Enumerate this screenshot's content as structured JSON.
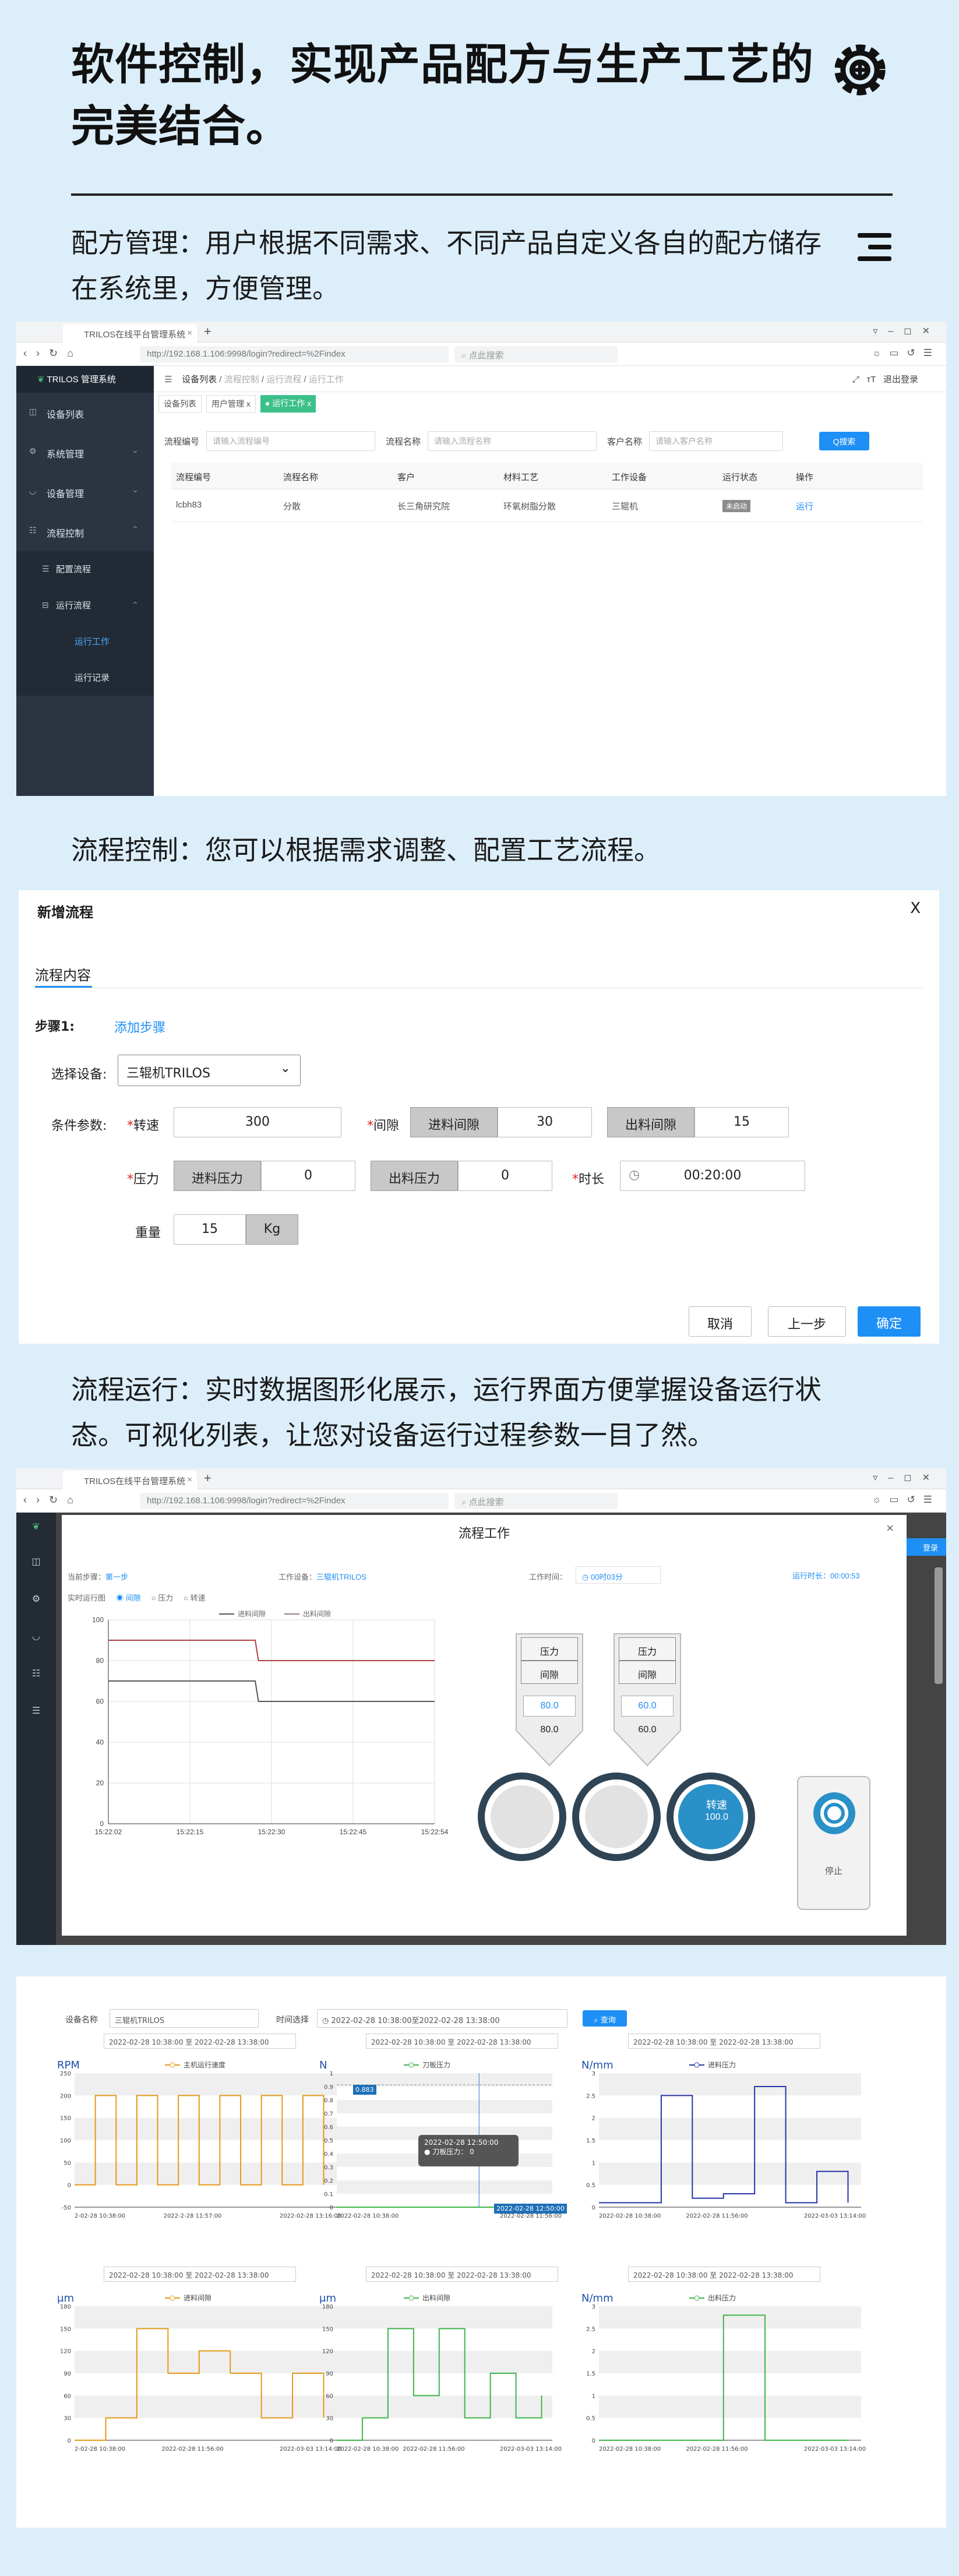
{
  "section1": {
    "title": "软件控制，实现产品配方与生产工艺的完美结合。",
    "gear": "gear-icon"
  },
  "recipe_para": "配方管理：用户根据不同需求、不同产品自定义各自的配方储存在系统里，方便管理。",
  "shot1": {
    "tab": "TRILOS在线平台管理系统",
    "url": "http://192.168.1.106:9998/login?redirect=%2Findex",
    "search_ph": "点此搜索",
    "brand": "TRILOS 管理系统",
    "menu": [
      {
        "label": "设备列表",
        "icon": "◫"
      },
      {
        "label": "系统管理",
        "icon": "⚙"
      },
      {
        "label": "设备管理",
        "icon": "◡"
      },
      {
        "label": "流程控制",
        "icon": "☷"
      }
    ],
    "submenu": [
      {
        "label": "配置流程",
        "icon": "☰"
      },
      {
        "label": "运行流程",
        "icon": "⊟"
      }
    ],
    "subsub": [
      "运行工作",
      "运行记录"
    ],
    "breadcrumb": [
      "设备列表",
      "流程控制",
      "运行流程",
      "运行工作"
    ],
    "header_right": "退出登录",
    "tags": [
      "设备列表",
      "用户管理 x",
      "● 运行工作 x"
    ],
    "filters": [
      {
        "label": "流程编号",
        "ph": "请输入流程编号"
      },
      {
        "label": "流程名称",
        "ph": "请输入流程名称"
      },
      {
        "label": "客户名称",
        "ph": "请输入客户名称"
      }
    ],
    "search_btn": "Q搜索",
    "columns": [
      "流程编号",
      "流程名称",
      "客户",
      "材料工艺",
      "工作设备",
      "运行状态",
      "操作"
    ],
    "row": [
      "lcbh83",
      "分散",
      "长三角研究院",
      "环氧树脂分散",
      "三辊机",
      "未启动",
      "运行"
    ]
  },
  "flow_para": "流程控制：您可以根据需求调整、配置工艺流程。",
  "dialog": {
    "title": "新增流程",
    "close": "X",
    "tab": "流程内容",
    "step": "步骤1:",
    "add_step": "添加步骤",
    "device_label": "选择设备:",
    "device": "三辊机TRILOS",
    "params_label": "条件参数:",
    "speed_label": "转速",
    "speed": "300",
    "gap_label": "间隙",
    "in_gap": "进料间隙",
    "in_gap_val": "30",
    "out_gap": "出料间隙",
    "out_gap_val": "15",
    "pressure_label": "压力",
    "in_p": "进料压力",
    "in_p_val": "0",
    "out_p": "出料压力",
    "out_p_val": "0",
    "time_label": "时长",
    "time": "00:20:00",
    "weight_label": "重量",
    "weight": "15",
    "unit": "Kg",
    "cancel": "取消",
    "prev": "上一步",
    "ok": "确定"
  },
  "run_para": "流程运行：实时数据图形化展示，运行界面方便掌握设备运行状态。可视化列表，让您对设备运行过程参数一目了然。",
  "shot2": {
    "title": "流程工作",
    "close": "×",
    "logout": "登录",
    "cur_step_label": "当前步骤：",
    "cur_step": "第一步",
    "device_label": "工作设备：",
    "device": "三辊机TRILOS",
    "work_time_label": "工作时间：",
    "work_time": "00时03分",
    "run_len_label": "运行时长：",
    "run_len": "00:00:53",
    "monitor_label": "实时运行图",
    "radios": [
      "间隙",
      "压力",
      "转速"
    ],
    "legend": [
      "进料间隙",
      "出料间隙"
    ],
    "p1": {
      "t1": "压力",
      "t2": "间隙",
      "val": "80.0",
      "below": "80.0"
    },
    "p2": {
      "t1": "压力",
      "t2": "间隙",
      "val": "60.0",
      "below": "60.0"
    },
    "rotor_label": "转速",
    "rotor_val": "100.0",
    "stop": "停止"
  },
  "shot3": {
    "device_label": "设备名称",
    "device": "三辊机TRILOS",
    "time_label": "时间选择",
    "range": "2022-02-28 10:38:00至2022-02-28 13:38:00",
    "query": "查询",
    "picker": "2022-02-28 10:38:00 至 2022-02-28 13:38:00",
    "tooltip_time": "2022-02-28 12:50:00",
    "tooltip_val": "● 刀板压力： 0",
    "cursor_y": "0.883",
    "cursor_x": "2022-02-28 12:50:00"
  },
  "chart_data": [
    {
      "type": "line",
      "title": "",
      "legend": [
        "进料间隙",
        "出料间隙"
      ],
      "x": [
        "15:22:02",
        "15:22:15",
        "15:22:30",
        "15:22:45",
        "15:22:54"
      ],
      "ylim": [
        0,
        100
      ],
      "series": [
        {
          "name": "进料间隙",
          "values": [
            90,
            90,
            80,
            80,
            80
          ]
        },
        {
          "name": "出料间隙",
          "values": [
            70,
            70,
            60,
            60,
            60
          ]
        }
      ]
    },
    {
      "type": "line",
      "ylabel": "RPM",
      "legend": [
        "主机运行速度"
      ],
      "ylim": [
        -50,
        250
      ],
      "yticks": [
        "250",
        "200",
        "150",
        "100",
        "50",
        "0",
        "-50"
      ],
      "xticks": [
        "2-02-28 10:38:00",
        "2022-2-28 11:57:00",
        "2022-02-28 13:16:00"
      ],
      "series": [
        {
          "name": "主机运行速度",
          "values": [
            0,
            200,
            0,
            200,
            0,
            200,
            0,
            200,
            0,
            200,
            0,
            200,
            0
          ]
        }
      ]
    },
    {
      "type": "line",
      "ylabel": "N",
      "legend": [
        "刀板压力"
      ],
      "ylim": [
        0,
        1
      ],
      "yticks": [
        "1",
        "0.9",
        "0.8",
        "0.7",
        "0.6",
        "0.5",
        "0.4",
        "0.3",
        "0.2",
        "0.1",
        "0"
      ],
      "xticks": [
        "2022-02-28 10:38:00",
        "2022-02-28 11:56:00"
      ],
      "series": [
        {
          "name": "刀板压力",
          "values": [
            0,
            0,
            0,
            0,
            0
          ]
        }
      ]
    },
    {
      "type": "line",
      "ylabel": "N/mm",
      "legend": [
        "进料压力"
      ],
      "ylim": [
        0,
        3
      ],
      "yticks": [
        "3",
        "2.5",
        "2",
        "1.5",
        "1",
        "0.5",
        "0"
      ],
      "xticks": [
        "2022-02-28 10:38:00",
        "2022-02-28 11:56:00",
        "2022-03-03 13:14:00"
      ],
      "series": [
        {
          "name": "进料压力",
          "values": [
            0.1,
            0.1,
            2.5,
            0.2,
            0.3,
            2.7,
            0.1,
            0.8,
            0.1
          ]
        }
      ]
    },
    {
      "type": "line",
      "ylabel": "μm",
      "legend": [
        "进料间隙"
      ],
      "ylim": [
        0,
        180
      ],
      "yticks": [
        "180",
        "150",
        "120",
        "90",
        "60",
        "30",
        "0"
      ],
      "xticks": [
        "2-02-28 10:38:00",
        "2022-02-28 11:56:00",
        "2022-03-03 13:14:00"
      ],
      "series": [
        {
          "name": "进料间隙",
          "values": [
            0,
            30,
            150,
            90,
            120,
            90,
            30,
            90,
            30
          ]
        }
      ]
    },
    {
      "type": "line",
      "ylabel": "μm",
      "legend": [
        "出料间隙"
      ],
      "ylim": [
        0,
        180
      ],
      "yticks": [
        "180",
        "150",
        "120",
        "90",
        "60",
        "30",
        "0"
      ],
      "xticks": [
        "2022-02-28 10:38:00",
        "2022-02-28 11:56:00",
        "2022-03-03 13:14:00"
      ],
      "series": [
        {
          "name": "出料间隙",
          "values": [
            0,
            30,
            150,
            60,
            150,
            30,
            90,
            30,
            60
          ]
        }
      ]
    },
    {
      "type": "line",
      "ylabel": "N/mm",
      "legend": [
        "出料压力"
      ],
      "ylim": [
        0,
        3
      ],
      "yticks": [
        "3",
        "2.5",
        "2",
        "1.5",
        "1",
        "0.5",
        "0"
      ],
      "xticks": [
        "2022-02-28 10:38:00",
        "2022-02-28 11:56:00",
        "2022-03-03 13:14:00"
      ],
      "series": [
        {
          "name": "出料压力",
          "values": [
            0,
            0,
            0,
            2.8,
            0,
            0,
            0
          ]
        }
      ]
    }
  ]
}
